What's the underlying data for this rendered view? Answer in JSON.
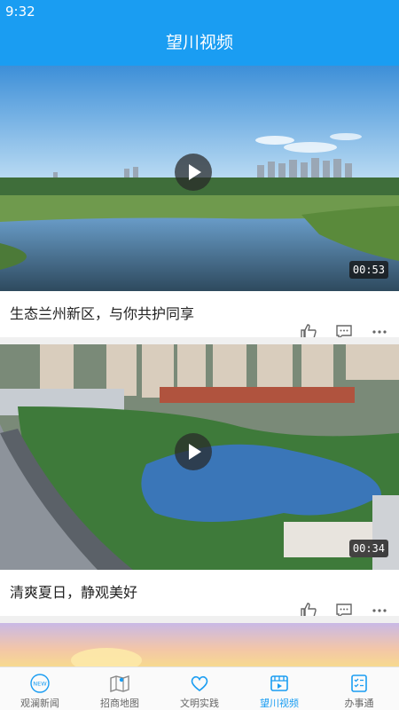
{
  "status_bar": {
    "time": "9:32"
  },
  "header": {
    "title": "望川视频"
  },
  "videos": [
    {
      "title": "生态兰州新区，与你共护同享",
      "duration": "00:53"
    },
    {
      "title": "清爽夏日，静观美好",
      "duration": "00:34"
    }
  ],
  "tabs": [
    {
      "label": "观澜新闻",
      "icon": "news-icon"
    },
    {
      "label": "招商地图",
      "icon": "map-icon"
    },
    {
      "label": "文明实践",
      "icon": "heart-icon"
    },
    {
      "label": "望川视频",
      "icon": "video-icon"
    },
    {
      "label": "办事通",
      "icon": "checklist-icon"
    }
  ],
  "active_tab": 3,
  "colors": {
    "brand": "#1a9df2",
    "inactive": "#666666"
  }
}
